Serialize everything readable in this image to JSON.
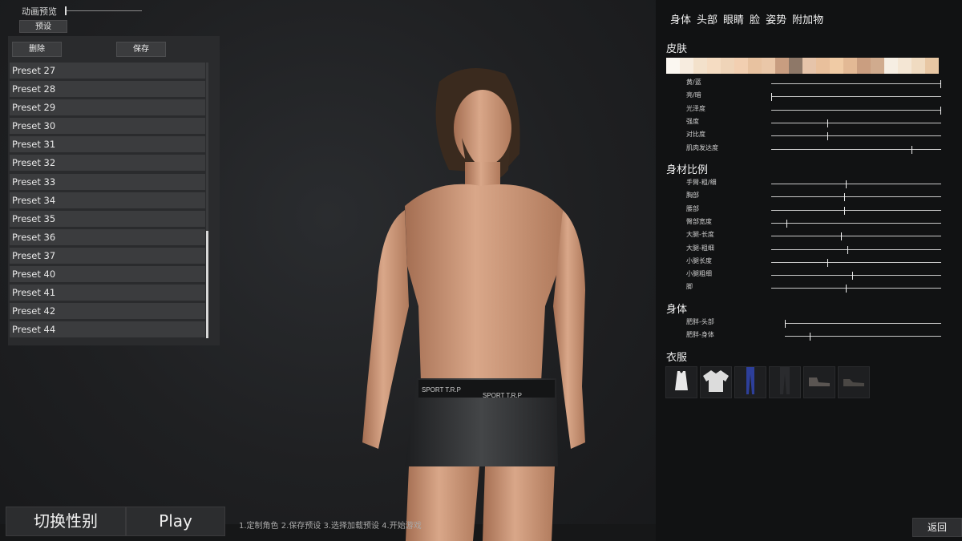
{
  "anim_preview": {
    "label": "动画预览",
    "value": 0.0
  },
  "preset_top_button": "预设",
  "preset_panel": {
    "delete_label": "删除",
    "save_label": "保存",
    "items": [
      "Preset 27",
      "Preset 28",
      "Preset 29",
      "Preset 30",
      "Preset 31",
      "Preset 32",
      "Preset 33",
      "Preset 34",
      "Preset 35",
      "Preset 36",
      "Preset 37",
      "Preset 40",
      "Preset 41",
      "Preset 42",
      "Preset 44"
    ],
    "scroll_position": 0.72
  },
  "bottom": {
    "gender_label": "切换性别",
    "play_label": "Play",
    "steps": "1.定制角色 2.保存预设 3.选择加载预设 4.开始游戏"
  },
  "underwear_text": "SPORT T.R.P",
  "right_panel": {
    "tabs": [
      "身体",
      "头部",
      "眼睛",
      "脸",
      "姿势",
      "附加物"
    ],
    "skin": {
      "title": "皮肤",
      "swatch_colors": [
        "#fbf7f1",
        "#f7ecdf",
        "#f3e1cb",
        "#f5dcc2",
        "#efd4b8",
        "#f2cfb1",
        "#e8c2a0",
        "#eac7a8",
        "#c89d80",
        "#8e7868",
        "#e6c4aa",
        "#e9c09c",
        "#f0cba5",
        "#e3b995",
        "#ca9e80",
        "#d0ab8e",
        "#f6eee3",
        "#f4e6d4",
        "#f0dbc1",
        "#e8c7a4"
      ],
      "sliders": [
        {
          "label": "黄/蓝",
          "value": 1.0
        },
        {
          "label": "亮/暗",
          "value": 0.0
        },
        {
          "label": "光泽度",
          "value": 1.0
        },
        {
          "label": "强度",
          "value": 0.33
        },
        {
          "label": "对比度",
          "value": 0.33
        },
        {
          "label": "肌肉发达度",
          "value": 0.83
        }
      ]
    },
    "proportions": {
      "title": "身材比例",
      "sliders": [
        {
          "label": "手臂-粗/细",
          "value": 0.44
        },
        {
          "label": "胸部",
          "value": 0.43
        },
        {
          "label": "腰部",
          "value": 0.43
        },
        {
          "label": "臀部宽度",
          "value": 0.09
        },
        {
          "label": "大腿-长度",
          "value": 0.41
        },
        {
          "label": "大腿-粗细",
          "value": 0.45
        },
        {
          "label": "小腿长度",
          "value": 0.33
        },
        {
          "label": "小腿粗细",
          "value": 0.48
        },
        {
          "label": "脚",
          "value": 0.44
        }
      ]
    },
    "body": {
      "title": "身体",
      "sliders": [
        {
          "label": "肥胖-头部",
          "value": 0.0
        },
        {
          "label": "肥胖-身体",
          "value": 0.16
        }
      ]
    },
    "clothes": {
      "title": "衣服",
      "items": [
        "tank-top-icon",
        "shirt-icon",
        "blue-pants-icon",
        "dark-pants-icon",
        "boot-icon",
        "shoe-icon"
      ]
    },
    "back_label": "返回"
  }
}
